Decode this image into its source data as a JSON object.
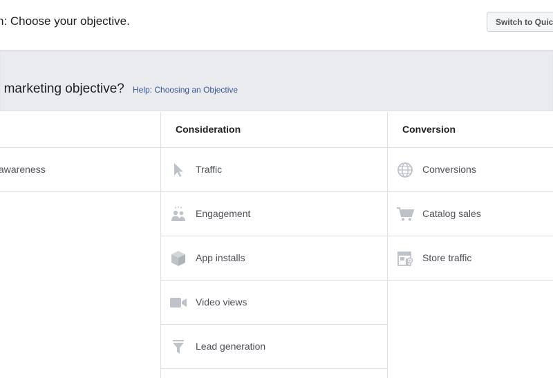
{
  "header": {
    "step_text": "n: Choose your objective.",
    "switch_button": "Switch to Quick"
  },
  "objective_section": {
    "question": "r marketing objective?",
    "help_link": "Help: Choosing an Objective"
  },
  "columns": {
    "awareness": {
      "header": "",
      "items": [
        {
          "label": "awareness",
          "icon": ""
        },
        {
          "label": "",
          "icon": ""
        }
      ]
    },
    "consideration": {
      "header": "Consideration",
      "items": [
        {
          "label": "Traffic",
          "icon": "cursor-icon"
        },
        {
          "label": "Engagement",
          "icon": "people-icon"
        },
        {
          "label": "App installs",
          "icon": "box-icon"
        },
        {
          "label": "Video views",
          "icon": "video-camera-icon"
        },
        {
          "label": "Lead generation",
          "icon": "funnel-icon"
        }
      ]
    },
    "conversion": {
      "header": "Conversion",
      "items": [
        {
          "label": "Conversions",
          "icon": "globe-icon"
        },
        {
          "label": "Catalog sales",
          "icon": "shopping-cart-icon"
        },
        {
          "label": "Store traffic",
          "icon": "storefront-icon"
        }
      ]
    }
  },
  "colors": {
    "band_background": "#e9ebee",
    "border": "#dddfe2",
    "link": "#365899",
    "icon": "#bec3c9",
    "text": "#4b4f56"
  }
}
